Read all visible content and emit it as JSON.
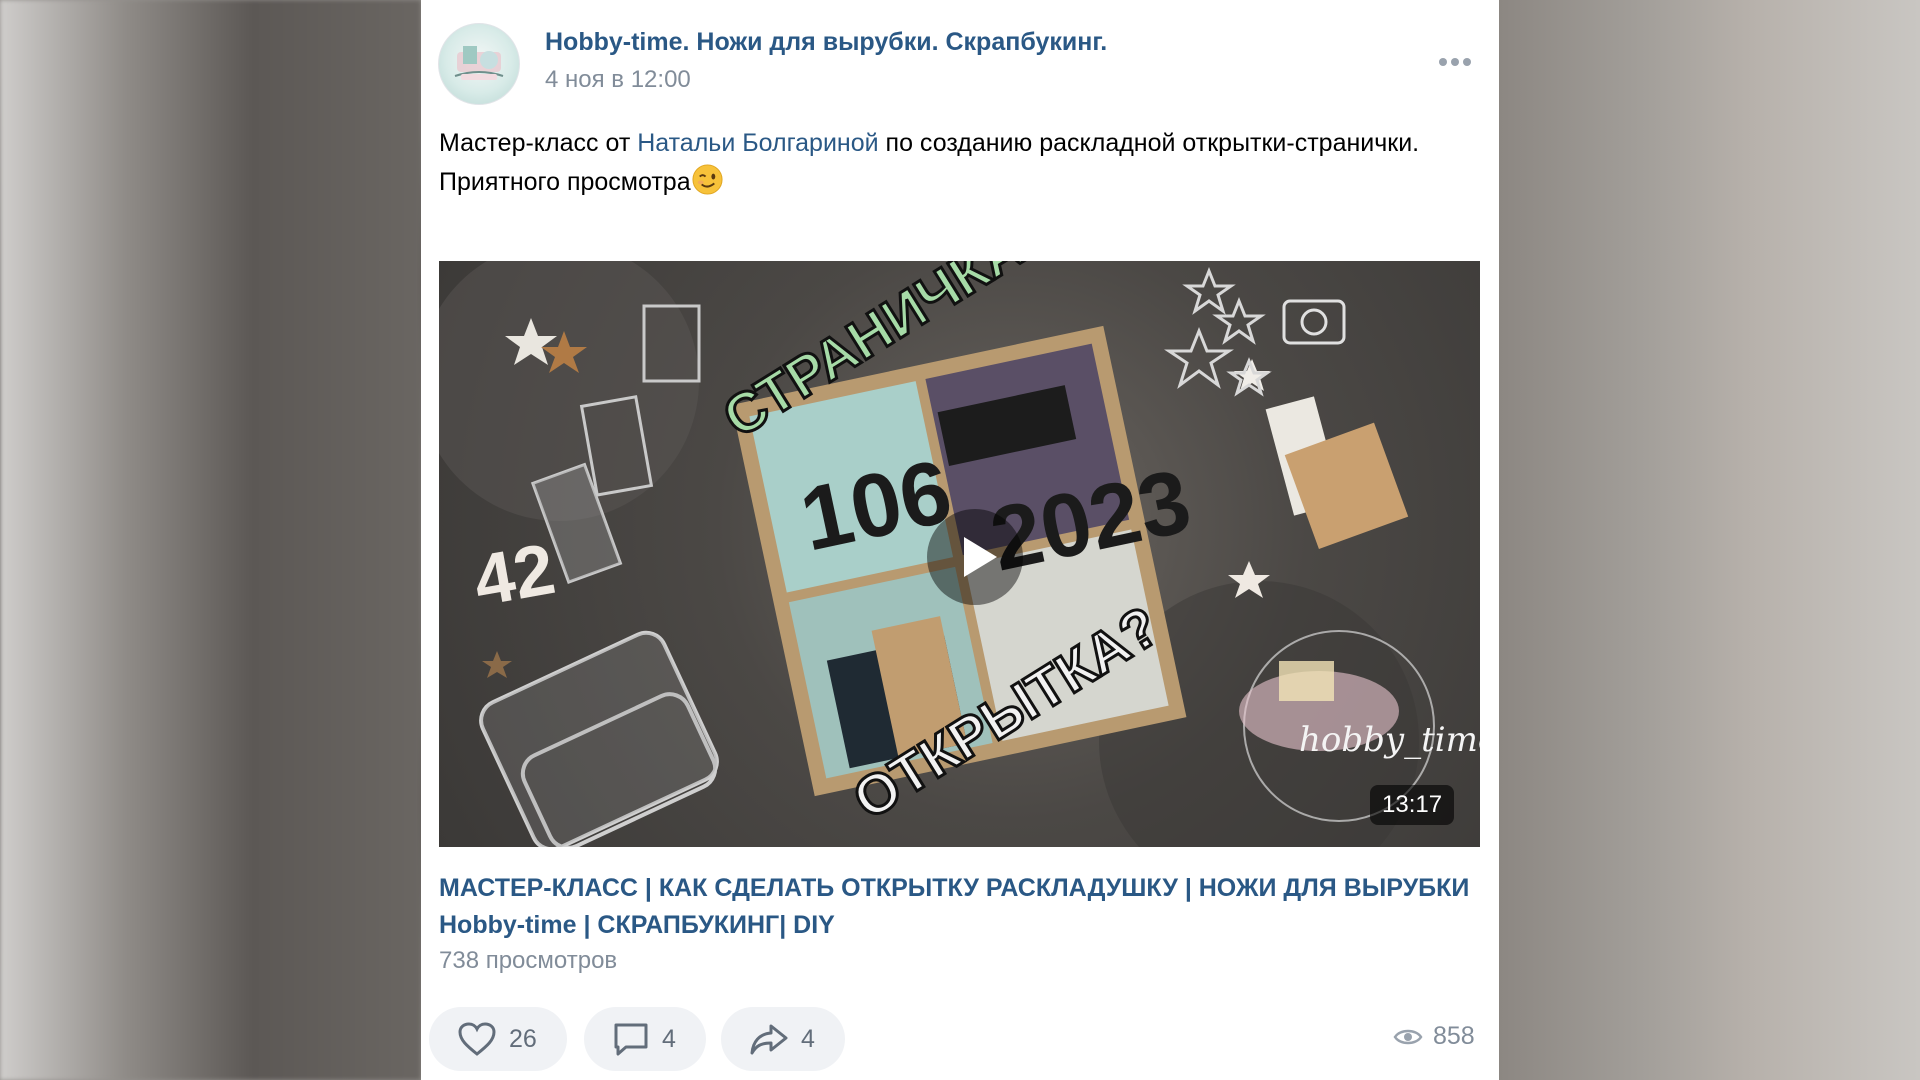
{
  "post": {
    "group_name": "Hobby-time. Ножи для вырубки. Скрапбукинг.",
    "date": "4 ноя в 12:00",
    "text_before_link": "Мастер-класс от ",
    "text_link": "Натальи Болгариной",
    "text_after_link": " по созданию раскладной открытки-странички.",
    "text_line2": "Приятного просмотра"
  },
  "video": {
    "duration": "13:17",
    "overlay_top": "СТРАНИЧКА?",
    "overlay_bottom": "ОТКРЫТКА?",
    "big_left": "106",
    "big_right": "2023",
    "numbers_left": "42",
    "watermark": "hobby_time",
    "title": "МАСТЕР-КЛАСС | КАК СДЕЛАТЬ ОТКРЫТКУ РАСКЛАДУШКУ | НОЖИ ДЛЯ ВЫРУБКИ Hobby-time | СКРАПБУКИНГ| DIY",
    "views": "738 просмотров"
  },
  "actions": {
    "likes": "26",
    "comments": "4",
    "shares": "4",
    "views": "858"
  },
  "icons": [
    "avatar",
    "more-icon",
    "wink-emoji",
    "play-icon",
    "heart-icon",
    "comment-icon",
    "share-icon",
    "eye-icon"
  ],
  "colors": {
    "link": "#2a5885",
    "muted": "#818c99",
    "button_bg": "#f0f2f5"
  }
}
